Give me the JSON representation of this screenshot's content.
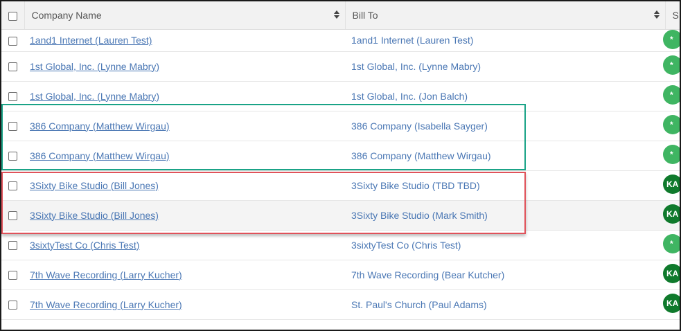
{
  "header": {
    "company_name": "Company Name",
    "bill_to": "Bill To",
    "status": "S"
  },
  "rows": [
    {
      "company": "1and1 Internet (Lauren Test)",
      "bill_to": "1and1 Internet (Lauren Test)",
      "badge": "*",
      "badge_style": "light"
    },
    {
      "company": "1st Global, Inc. (Lynne Mabry)",
      "bill_to": "1st Global, Inc. (Lynne Mabry)",
      "badge": "*",
      "badge_style": "light"
    },
    {
      "company": "1st Global, Inc. (Lynne Mabry)",
      "bill_to": "1st Global, Inc. (Jon Balch)",
      "badge": "*",
      "badge_style": "light"
    },
    {
      "company": "386 Company (Matthew Wirgau)",
      "bill_to": "386 Company (Isabella Sayger)",
      "badge": "*",
      "badge_style": "light"
    },
    {
      "company": "386 Company (Matthew Wirgau)",
      "bill_to": "386 Company (Matthew Wirgau)",
      "badge": "*",
      "badge_style": "light"
    },
    {
      "company": "3Sixty Bike Studio (Bill Jones)",
      "bill_to": "3Sixty Bike Studio (TBD TBD)",
      "badge": "KA",
      "badge_style": "dark"
    },
    {
      "company": "3Sixty Bike Studio (Bill Jones)",
      "bill_to": "3Sixty Bike Studio (Mark Smith)",
      "badge": "KA",
      "badge_style": "dark"
    },
    {
      "company": "3sixtyTest Co (Chris Test)",
      "bill_to": "3sixtyTest Co (Chris Test)",
      "badge": "*",
      "badge_style": "light"
    },
    {
      "company": "7th Wave Recording (Larry Kucher)",
      "bill_to": "7th Wave Recording (Bear Kutcher)",
      "badge": "KA",
      "badge_style": "dark"
    },
    {
      "company": "7th Wave Recording (Larry Kucher)",
      "bill_to": "St. Paul's Church (Paul Adams)",
      "badge": "KA",
      "badge_style": "dark"
    }
  ],
  "colors": {
    "link": "#4a77b4",
    "highlight_green": "#1aa387",
    "highlight_red": "#e0525a",
    "badge_light": "#3fb562",
    "badge_dark": "#0f7a2c"
  }
}
